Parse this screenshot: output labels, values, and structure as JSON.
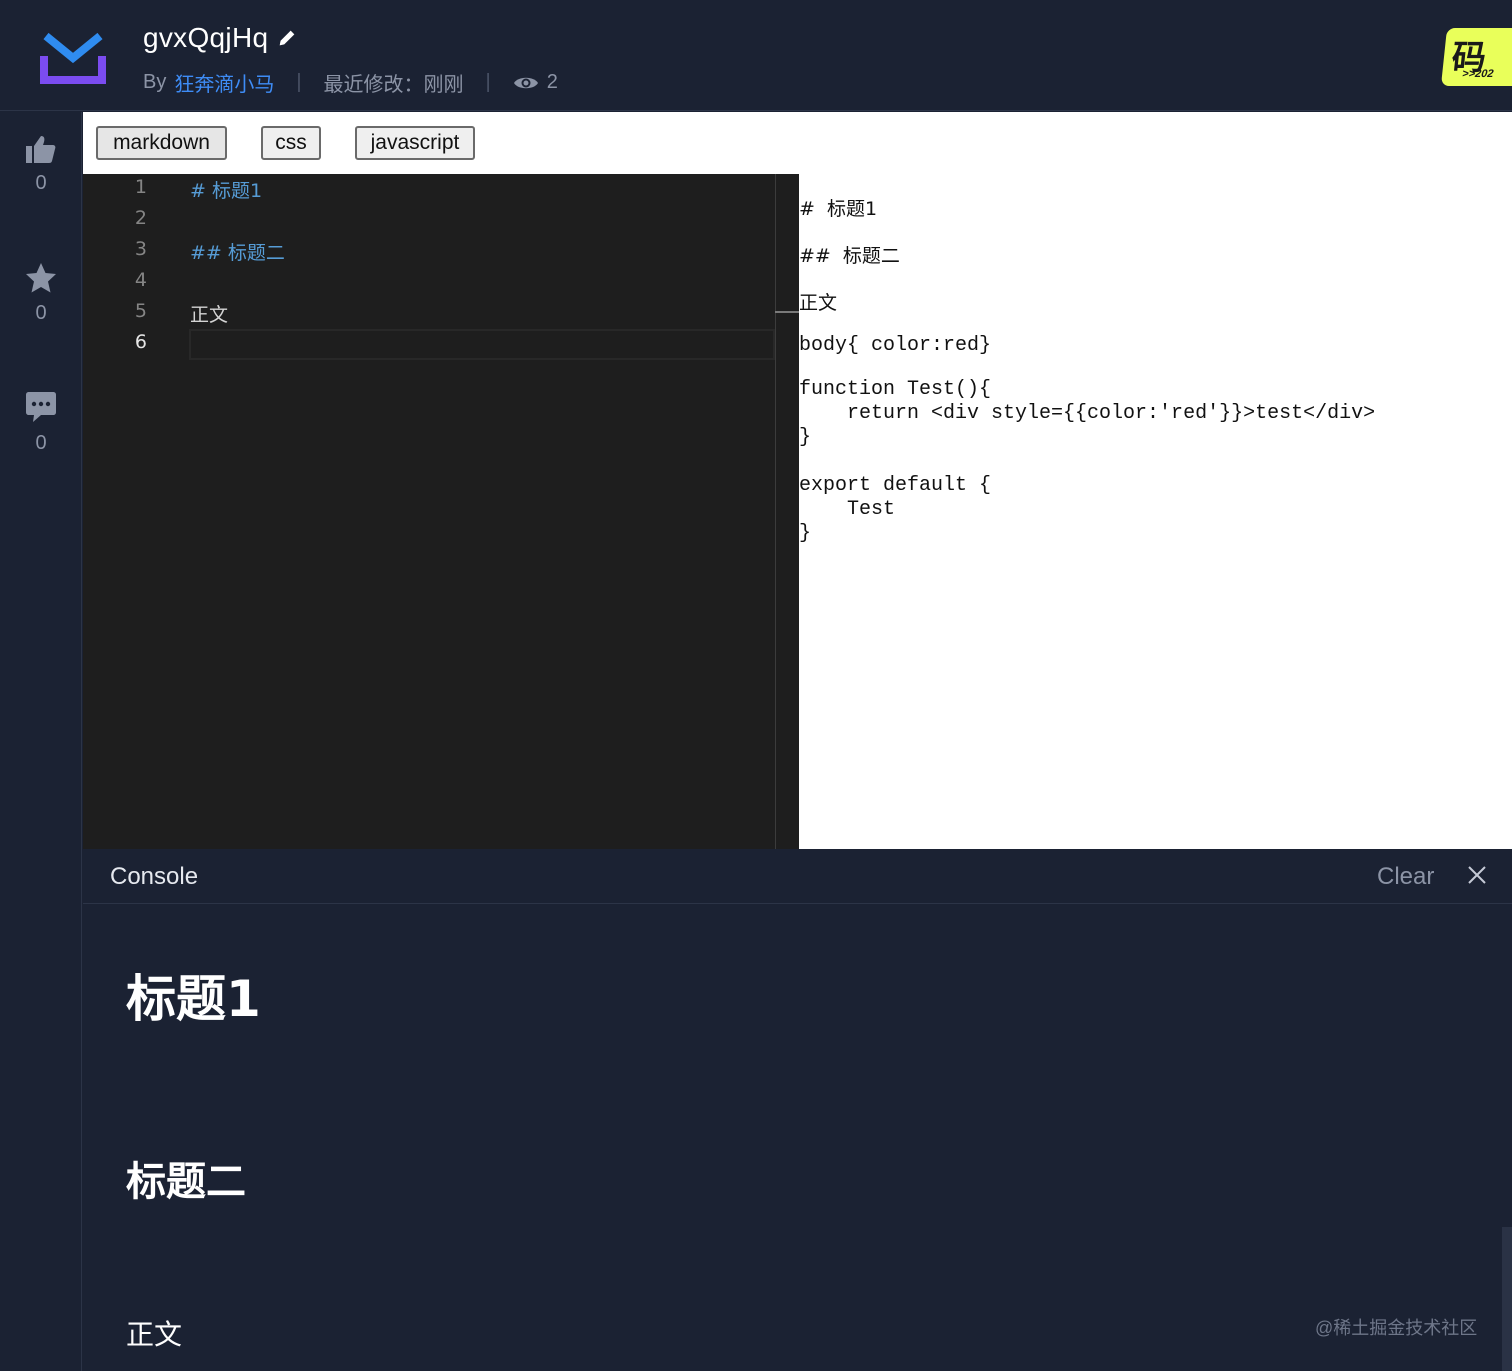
{
  "header": {
    "title": "gvxQqjHq",
    "by_label": "By",
    "author": "狂奔滴小马",
    "last_modified": "最近修改：刚刚",
    "views": "2",
    "badge_text": "码上",
    "badge_sub": ">>202"
  },
  "rail": {
    "likes": "0",
    "stars": "0",
    "comments": "0"
  },
  "tabs": [
    {
      "label": "markdown"
    },
    {
      "label": "css"
    },
    {
      "label": "javascript"
    }
  ],
  "editor": {
    "lines": [
      {
        "n": "1",
        "text": "#  标题1"
      },
      {
        "n": "2",
        "text": ""
      },
      {
        "n": "3",
        "text": "##  标题二"
      },
      {
        "n": "4",
        "text": ""
      },
      {
        "n": "5",
        "text": "正文"
      },
      {
        "n": "6",
        "text": ""
      }
    ]
  },
  "preview": {
    "md1": "#  标题1",
    "md2": "##  标题二",
    "md3": "正文",
    "css": "body{ color:red}",
    "js1": "function Test(){\n    return <div style={{color:'red'}}>test</div>\n}",
    "js2": "export default {\n    Test\n}"
  },
  "console": {
    "title": "Console",
    "clear": "Clear",
    "h1": "标题1",
    "h2": "标题二",
    "p": "正文"
  },
  "watermark": "@稀土掘金技术社区",
  "colors": {
    "background": "#1b2233",
    "accent": "#3e8cf6",
    "editor_bg": "#1e1e1e",
    "md_heading": "#569cd6",
    "badge": "#e9ff5a"
  }
}
